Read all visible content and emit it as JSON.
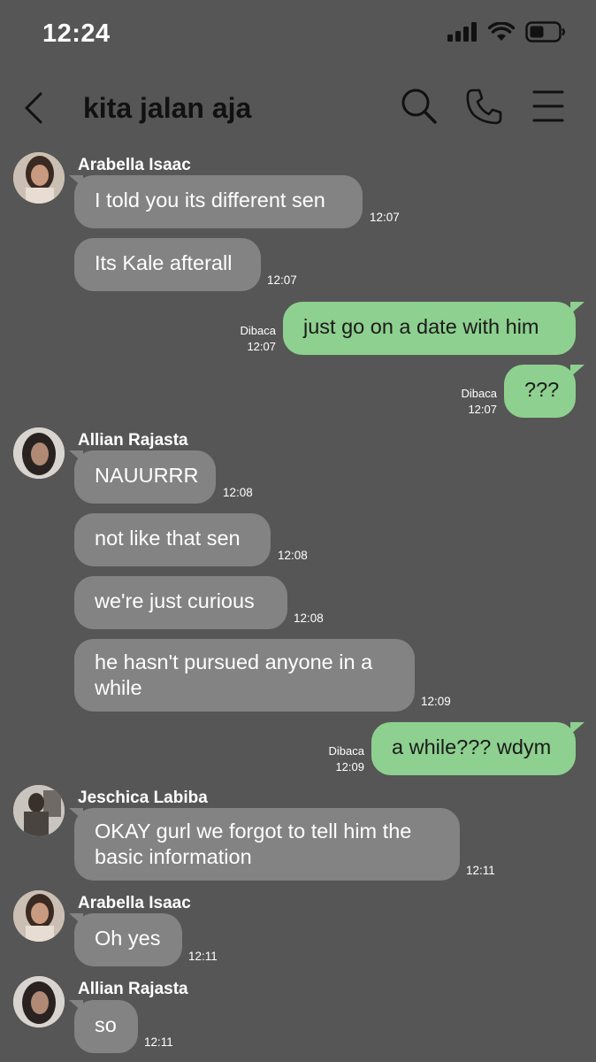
{
  "status": {
    "time": "12:24"
  },
  "header": {
    "title": "kita jalan aja",
    "icons": [
      "back-icon",
      "search-icon",
      "phone-icon",
      "menu-icon"
    ]
  },
  "messages": [
    {
      "sender": "Arabella Isaac",
      "text": "I told you its different sen",
      "time": "12:07"
    },
    {
      "text": "Its Kale afterall",
      "time": "12:07"
    },
    {
      "text": "just go on a date with him",
      "read": "Dibaca",
      "time": "12:07"
    },
    {
      "text": "???",
      "read": "Dibaca",
      "time": "12:07"
    },
    {
      "sender": "Allian Rajasta",
      "text": "NAUURRR",
      "time": "12:08"
    },
    {
      "text": "not like that sen",
      "time": "12:08"
    },
    {
      "text": "we're just curious",
      "time": "12:08"
    },
    {
      "text_line1": "he hasn't pursued anyone in a",
      "text_line2": "while",
      "time": "12:09"
    },
    {
      "text": "a while??? wdym",
      "read": "Dibaca",
      "time": "12:09"
    },
    {
      "sender": "Jeschica Labiba",
      "text_line1": "OKAY gurl we forgot to tell him the",
      "text_line2": "basic information",
      "time": "12:11"
    },
    {
      "sender": "Arabella Isaac",
      "text": "Oh yes",
      "time": "12:11"
    },
    {
      "sender": "Allian Rajasta",
      "text": "so",
      "time": "12:11"
    }
  ],
  "colors": {
    "background": "#565656",
    "incoming": "#838383",
    "outgoing": "#8ed08f"
  }
}
